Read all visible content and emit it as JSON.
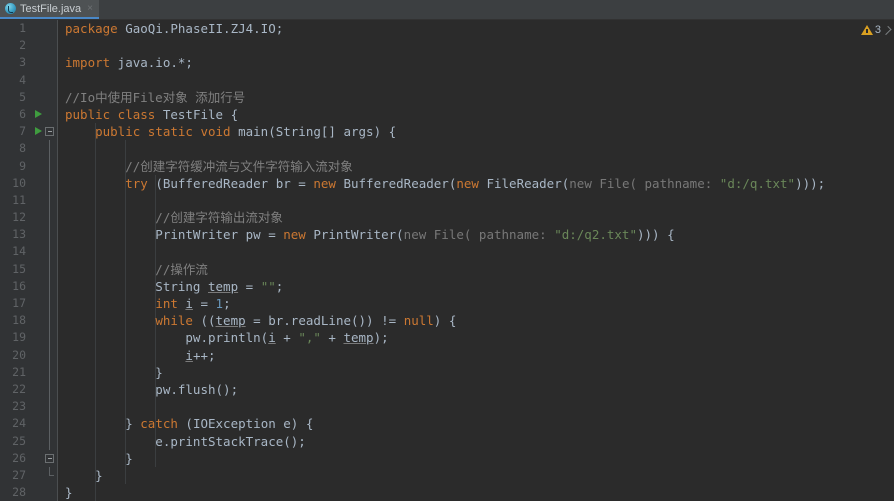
{
  "window": {
    "app": "IntelliJ IDEA editor",
    "theme_colors": {
      "editor_background": "#2b2b2b",
      "gutter_background": "#313335",
      "tab_background": "#4e5254",
      "tab_bar_background": "#3c3f41",
      "tab_underline": "#4a88c7",
      "default_text": "#a9b7c6",
      "keyword": "#cc7832",
      "string": "#6a8759",
      "number": "#6897bb",
      "comment": "#808080",
      "parameter_hint": "#787878",
      "line_number": "#606366",
      "run_marker": "#3f9c3f",
      "warning": "#d9a021"
    }
  },
  "tabs": [
    {
      "label": "TestFile.java",
      "icon": "java-class-icon",
      "close_label": "×",
      "active": true
    }
  ],
  "inspection_widget": {
    "icon": "warning-triangle-icon",
    "count": "3",
    "chevron": "chevron-icon"
  },
  "editor": {
    "line_numbers": [
      1,
      2,
      3,
      4,
      5,
      6,
      7,
      8,
      9,
      10,
      11,
      12,
      13,
      14,
      15,
      16,
      17,
      18,
      19,
      20,
      21,
      22,
      23,
      24,
      25,
      26,
      27,
      28
    ],
    "run_marker_lines": [
      6,
      7
    ],
    "fold_marker_lines": [
      7,
      26,
      27
    ],
    "lines": [
      {
        "n": 1,
        "tokens": [
          {
            "t": "package",
            "c": "kw"
          },
          {
            "t": " GaoQi.PhaseII.ZJ4.IO;",
            "c": "cls"
          }
        ]
      },
      {
        "n": 2,
        "tokens": []
      },
      {
        "n": 3,
        "tokens": [
          {
            "t": "import",
            "c": "kw"
          },
          {
            "t": " java.io.*;",
            "c": "cls"
          }
        ]
      },
      {
        "n": 4,
        "tokens": []
      },
      {
        "n": 5,
        "tokens": [
          {
            "t": "//Io中使用File对象 添加行号",
            "c": "cmt"
          }
        ]
      },
      {
        "n": 6,
        "tokens": [
          {
            "t": "public class",
            "c": "kw"
          },
          {
            "t": " TestFile {",
            "c": "cls"
          }
        ]
      },
      {
        "n": 7,
        "tokens": [
          {
            "t": "    ",
            "c": "cls"
          },
          {
            "t": "public static void",
            "c": "kw"
          },
          {
            "t": " main(String[] args) {",
            "c": "cls"
          }
        ]
      },
      {
        "n": 8,
        "tokens": []
      },
      {
        "n": 9,
        "tokens": [
          {
            "t": "        //创建字符缓冲流与文件字符输入流对象",
            "c": "cmt"
          }
        ]
      },
      {
        "n": 10,
        "tokens": [
          {
            "t": "        ",
            "c": "cls"
          },
          {
            "t": "try",
            "c": "kw"
          },
          {
            "t": " (BufferedReader br = ",
            "c": "cls"
          },
          {
            "t": "new",
            "c": "kw"
          },
          {
            "t": " BufferedReader(",
            "c": "cls"
          },
          {
            "t": "new",
            "c": "kw"
          },
          {
            "t": " FileReader(",
            "c": "cls"
          },
          {
            "t": "new File( pathname:",
            "c": "hint"
          },
          {
            "t": " ",
            "c": "cls"
          },
          {
            "t": "\"d:/q.txt\"",
            "c": "str"
          },
          {
            "t": ")));",
            "c": "cls"
          }
        ]
      },
      {
        "n": 11,
        "tokens": []
      },
      {
        "n": 12,
        "tokens": [
          {
            "t": "            //创建字符输出流对象",
            "c": "cmt"
          }
        ]
      },
      {
        "n": 13,
        "tokens": [
          {
            "t": "            PrintWriter pw = ",
            "c": "cls"
          },
          {
            "t": "new",
            "c": "kw"
          },
          {
            "t": " PrintWriter(",
            "c": "cls"
          },
          {
            "t": "new File( pathname:",
            "c": "hint"
          },
          {
            "t": " ",
            "c": "cls"
          },
          {
            "t": "\"d:/q2.txt\"",
            "c": "str"
          },
          {
            "t": "))) {",
            "c": "cls"
          }
        ]
      },
      {
        "n": 14,
        "tokens": []
      },
      {
        "n": 15,
        "tokens": [
          {
            "t": "            //操作流",
            "c": "cmt"
          }
        ]
      },
      {
        "n": 16,
        "tokens": [
          {
            "t": "            String ",
            "c": "cls"
          },
          {
            "t": "temp",
            "c": "var-u"
          },
          {
            "t": " = ",
            "c": "cls"
          },
          {
            "t": "\"\"",
            "c": "str"
          },
          {
            "t": ";",
            "c": "cls"
          }
        ]
      },
      {
        "n": 17,
        "tokens": [
          {
            "t": "            ",
            "c": "cls"
          },
          {
            "t": "int",
            "c": "kw"
          },
          {
            "t": " ",
            "c": "cls"
          },
          {
            "t": "i",
            "c": "var-u"
          },
          {
            "t": " = ",
            "c": "cls"
          },
          {
            "t": "1",
            "c": "num"
          },
          {
            "t": ";",
            "c": "cls"
          }
        ]
      },
      {
        "n": 18,
        "tokens": [
          {
            "t": "            ",
            "c": "cls"
          },
          {
            "t": "while",
            "c": "kw"
          },
          {
            "t": " ((",
            "c": "cls"
          },
          {
            "t": "temp",
            "c": "var-u"
          },
          {
            "t": " = br.readLine()) != ",
            "c": "cls"
          },
          {
            "t": "null",
            "c": "kw"
          },
          {
            "t": ") {",
            "c": "cls"
          }
        ]
      },
      {
        "n": 19,
        "tokens": [
          {
            "t": "                pw.println(",
            "c": "cls"
          },
          {
            "t": "i",
            "c": "var-u"
          },
          {
            "t": " + ",
            "c": "cls"
          },
          {
            "t": "\",\"",
            "c": "str"
          },
          {
            "t": " + ",
            "c": "cls"
          },
          {
            "t": "temp",
            "c": "var-u"
          },
          {
            "t": ");",
            "c": "cls"
          }
        ]
      },
      {
        "n": 20,
        "tokens": [
          {
            "t": "                ",
            "c": "cls"
          },
          {
            "t": "i",
            "c": "var-u"
          },
          {
            "t": "++;",
            "c": "cls"
          }
        ]
      },
      {
        "n": 21,
        "tokens": [
          {
            "t": "            }",
            "c": "cls"
          }
        ]
      },
      {
        "n": 22,
        "tokens": [
          {
            "t": "            pw.flush();",
            "c": "cls"
          }
        ]
      },
      {
        "n": 23,
        "tokens": []
      },
      {
        "n": 24,
        "tokens": [
          {
            "t": "        } ",
            "c": "cls"
          },
          {
            "t": "catch",
            "c": "kw"
          },
          {
            "t": " (IOException e) {",
            "c": "cls"
          }
        ]
      },
      {
        "n": 25,
        "tokens": [
          {
            "t": "            e.printStackTrace();",
            "c": "cls"
          }
        ]
      },
      {
        "n": 26,
        "tokens": [
          {
            "t": "        }",
            "c": "cls"
          }
        ]
      },
      {
        "n": 27,
        "tokens": [
          {
            "t": "    }",
            "c": "cls"
          }
        ]
      },
      {
        "n": 28,
        "tokens": [
          {
            "t": "}",
            "c": "cls"
          }
        ]
      }
    ]
  }
}
